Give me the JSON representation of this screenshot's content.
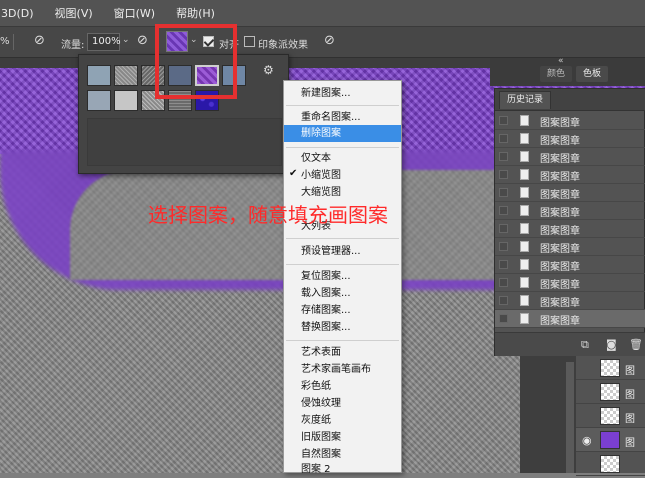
{
  "menubar": {
    "items": [
      "3D(D)",
      "视图(V)",
      "窗口(W)",
      "帮助(H)"
    ]
  },
  "options": {
    "opacity_value": "%",
    "flow_label": "流量:",
    "flow_value": "100%",
    "aligned_label": "对齐",
    "impressionist_label": "印象派效果"
  },
  "tabs": {
    "collapse": "«",
    "tab1": "颜色",
    "tab2": "色板"
  },
  "picker": {
    "swatch_colors": [
      "#8fa3b4",
      "#9a9a9a",
      "#7f7f7f",
      "#5b6a86",
      "#8b3fd0",
      "#6f87a5",
      "#98a6b5",
      "#c6c6c6",
      "#a6a6a6",
      "#7a7a7a",
      "#2a18a8"
    ],
    "gear_label": "⚙"
  },
  "context_menu": {
    "items": [
      {
        "label": "新建图案...",
        "selected": false
      },
      {
        "label": "重命名图案...",
        "selected": false
      },
      {
        "label": "删除图案",
        "selected": true
      },
      {
        "label": "仅文本",
        "selected": false
      },
      {
        "label": "小缩览图",
        "selected": false,
        "checked": true
      },
      {
        "label": "大缩览图",
        "selected": false
      },
      {
        "label": "大列表",
        "selected": false
      },
      {
        "label": "预设管理器...",
        "selected": false
      },
      {
        "label": "复位图案...",
        "selected": false
      },
      {
        "label": "载入图案...",
        "selected": false
      },
      {
        "label": "存储图案...",
        "selected": false
      },
      {
        "label": "替换图案...",
        "selected": false
      },
      {
        "label": "艺术表面",
        "selected": false
      },
      {
        "label": "艺术家画笔画布",
        "selected": false
      },
      {
        "label": "彩色纸",
        "selected": false
      },
      {
        "label": "侵蚀纹理",
        "selected": false
      },
      {
        "label": "灰度纸",
        "selected": false
      },
      {
        "label": "旧版图案",
        "selected": false
      },
      {
        "label": "自然图案",
        "selected": false
      },
      {
        "label": "图案 2",
        "selected": false
      }
    ],
    "check_mark": "✔"
  },
  "annotation": "选择图案，随意填充画图案",
  "history": {
    "title": "历史记录",
    "entries": [
      "图案图章",
      "图案图章",
      "图案图章",
      "图案图章",
      "图案图章",
      "图案图章",
      "图案图章",
      "图案图章",
      "图案图章",
      "图案图章",
      "图案图章",
      "图案图章"
    ]
  },
  "layers": {
    "names": [
      "图",
      "图",
      "图",
      "图"
    ]
  }
}
